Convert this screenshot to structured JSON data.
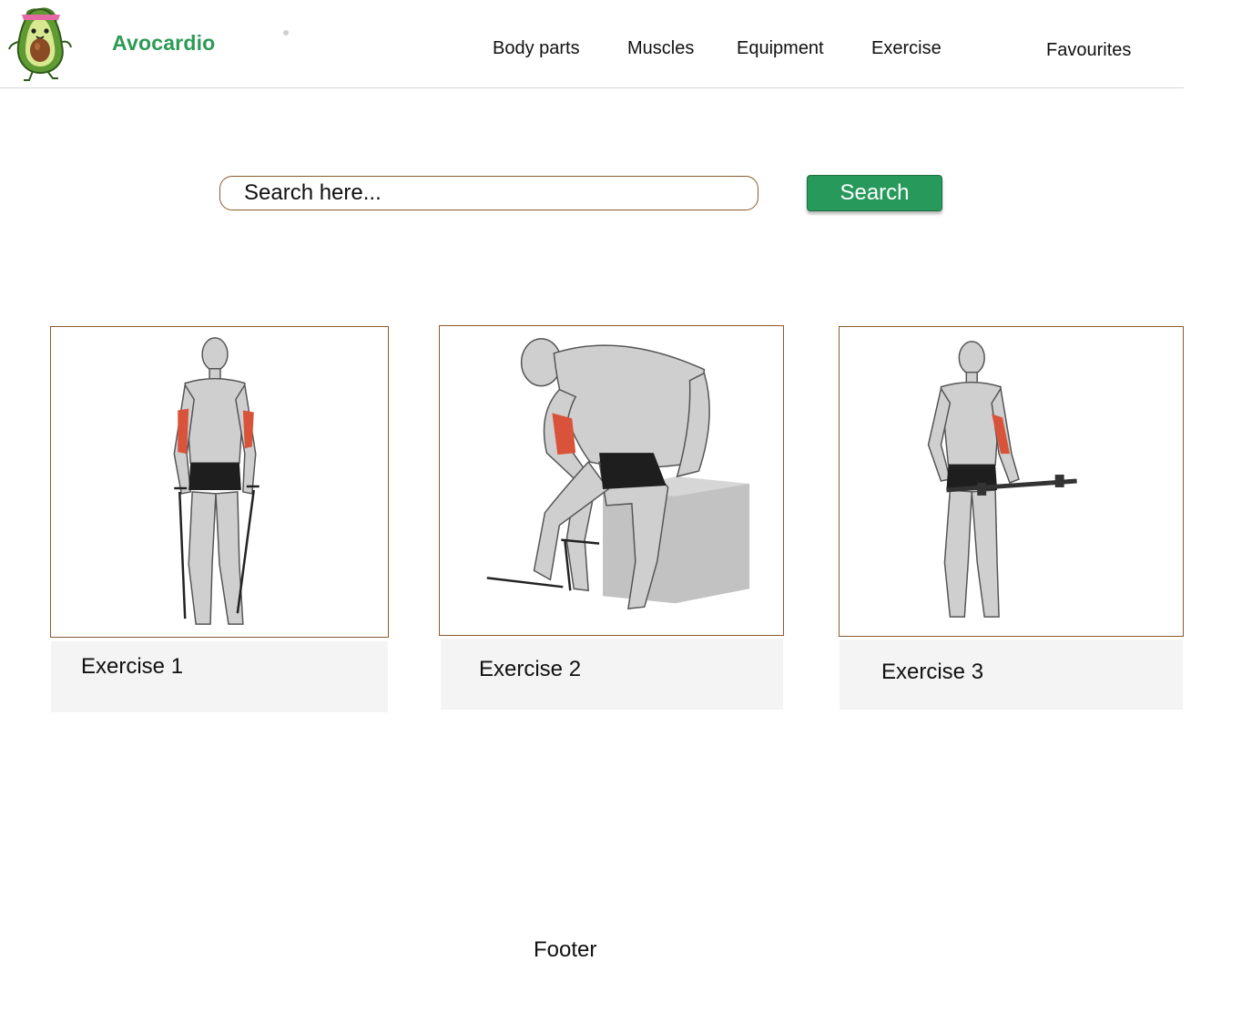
{
  "header": {
    "brand": "Avocardio",
    "nav": [
      "Body parts",
      "Muscles",
      "Equipment",
      "Exercise"
    ],
    "favourites": "Favourites"
  },
  "search": {
    "placeholder": "Search here...",
    "button_label": "Search"
  },
  "exercises": [
    {
      "label": "Exercise 1",
      "image": "cable-curl-standing-illustration"
    },
    {
      "label": "Exercise 2",
      "image": "seated-cable-concentration-curl-illustration"
    },
    {
      "label": "Exercise 3",
      "image": "barbell-standing-illustration"
    }
  ],
  "footer": {
    "label": "Footer"
  },
  "colors": {
    "brand": "#2d9a55",
    "search_button": "#279a5b",
    "border": "#8a5a2b",
    "highlight_muscle": "#d9533a"
  }
}
